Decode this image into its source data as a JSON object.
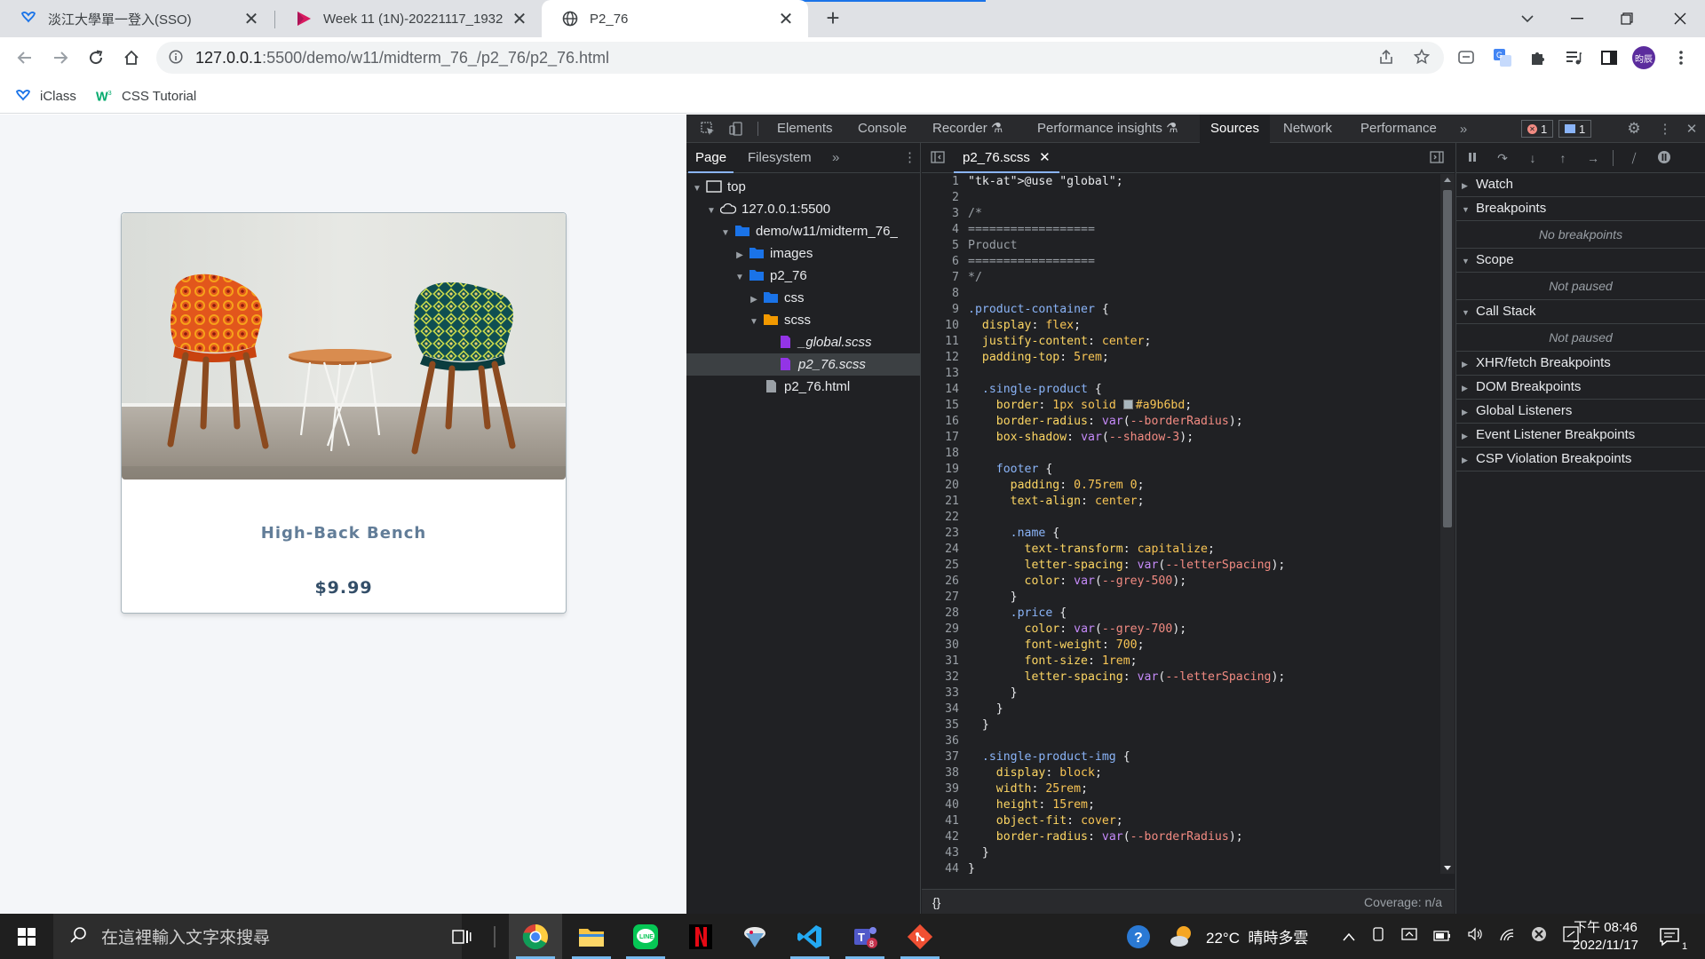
{
  "browser": {
    "tabs": [
      {
        "title": "淡江大學單一登入(SSO)",
        "icon": "tku-icon",
        "active": false
      },
      {
        "title": "Week 11 (1N)-20221117_1932",
        "icon": "video-play-icon",
        "active": false
      },
      {
        "title": "P2_76",
        "icon": "globe-icon",
        "active": true
      }
    ],
    "new_tab_label": "+",
    "url_host": "127.0.0.1",
    "url_path": ":5500/demo/w11/midterm_76_/p2_76/p2_76.html",
    "profile_initials": "昀辰",
    "bookmarks": [
      {
        "label": "iClass",
        "icon": "iclass-icon"
      },
      {
        "label": "CSS Tutorial",
        "icon": "w3schools-icon"
      }
    ]
  },
  "page": {
    "product_name": "High-Back Bench",
    "product_price": "$9.99"
  },
  "devtools": {
    "tabs": [
      "Elements",
      "Console",
      "Recorder",
      "Performance insights",
      "Sources",
      "Network",
      "Performance"
    ],
    "active_tab": "Sources",
    "error_count": "1",
    "message_count": "1",
    "navigator_tabs": [
      "Page",
      "Filesystem"
    ],
    "tree": [
      {
        "label": "top",
        "depth": 0,
        "icon": "frame-icon",
        "expanded": true
      },
      {
        "label": "127.0.0.1:5500",
        "depth": 1,
        "icon": "cloud-icon",
        "expanded": true
      },
      {
        "label": "demo/w11/midterm_76_",
        "depth": 2,
        "icon": "folder-icon",
        "expanded": true
      },
      {
        "label": "images",
        "depth": 3,
        "icon": "folder-icon",
        "expanded": false
      },
      {
        "label": "p2_76",
        "depth": 3,
        "icon": "folder-icon",
        "expanded": true
      },
      {
        "label": "css",
        "depth": 4,
        "icon": "folder-icon",
        "expanded": false
      },
      {
        "label": "scss",
        "depth": 4,
        "icon": "folder-orange-icon",
        "expanded": true
      },
      {
        "label": "_global.scss",
        "depth": 5,
        "icon": "file-purple-icon",
        "italic": true
      },
      {
        "label": "p2_76.scss",
        "depth": 5,
        "icon": "file-purple-icon",
        "italic": true,
        "selected": true
      },
      {
        "label": "p2_76.html",
        "depth": 4,
        "icon": "file-icon"
      }
    ],
    "editor_tab": "p2_76.scss",
    "code": [
      "@use \"global\";",
      "",
      "/*",
      "==================",
      "Product",
      "==================",
      "*/",
      "",
      ".product-container {",
      "  display: flex;",
      "  justify-content: center;",
      "  padding-top: 5rem;",
      "",
      "  .single-product {",
      "    border: 1px solid #a9b6bd;",
      "    border-radius: var(--borderRadius);",
      "    box-shadow: var(--shadow-3);",
      "",
      "    footer {",
      "      padding: 0.75rem 0;",
      "      text-align: center;",
      "",
      "      .name {",
      "        text-transform: capitalize;",
      "        letter-spacing: var(--letterSpacing);",
      "        color: var(--grey-500);",
      "      }",
      "      .price {",
      "        color: var(--grey-700);",
      "        font-weight: 700;",
      "        font-size: 1rem;",
      "        letter-spacing: var(--letterSpacing);",
      "      }",
      "    }",
      "  }",
      "",
      "  .single-product-img {",
      "    display: block;",
      "    width: 25rem;",
      "    height: 15rem;",
      "    object-fit: cover;",
      "    border-radius: var(--borderRadius);",
      "  }",
      "}"
    ],
    "status_left": "{}",
    "coverage": "Coverage: n/a",
    "debugger_panes": [
      {
        "label": "Watch",
        "expanded": false
      },
      {
        "label": "Breakpoints",
        "expanded": true,
        "empty": "No breakpoints"
      },
      {
        "label": "Scope",
        "expanded": true,
        "empty": "Not paused"
      },
      {
        "label": "Call Stack",
        "expanded": true,
        "empty": "Not paused"
      },
      {
        "label": "XHR/fetch Breakpoints",
        "expanded": false
      },
      {
        "label": "DOM Breakpoints",
        "expanded": false
      },
      {
        "label": "Global Listeners",
        "expanded": false
      },
      {
        "label": "Event Listener Breakpoints",
        "expanded": false
      },
      {
        "label": "CSP Violation Breakpoints",
        "expanded": false
      }
    ]
  },
  "taskbar": {
    "search_placeholder": "在這裡輸入文字來搜尋",
    "weather": "22°C  晴時多雲",
    "time": "下午 08:46",
    "date": "2022/11/17",
    "notification_count": "1",
    "teams_badge": "8"
  },
  "colors": {
    "accent": "#1a73e8",
    "card_border": "#a9b6bd",
    "name_color": "#627d98",
    "price_color": "#334e68"
  }
}
